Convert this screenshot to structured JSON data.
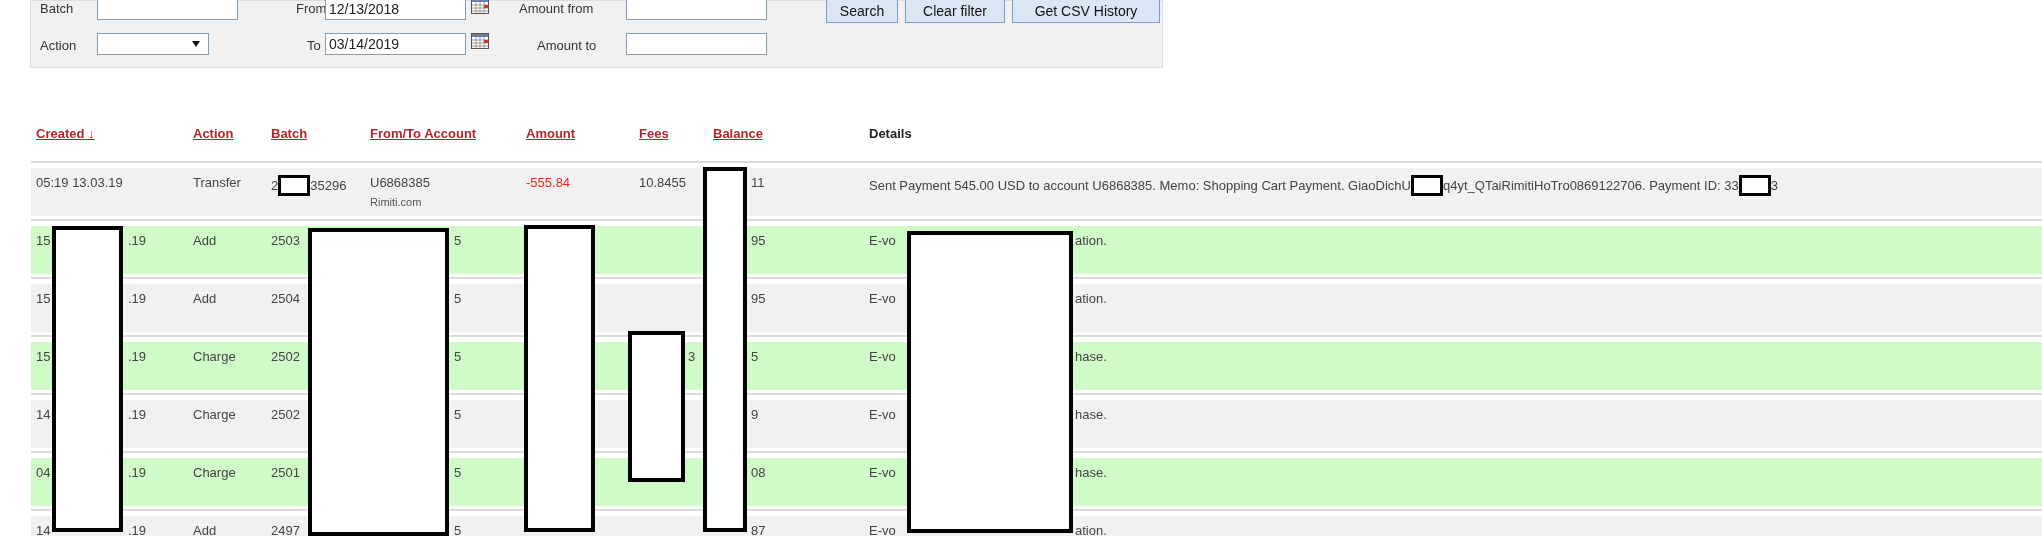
{
  "filters": {
    "batch_label": "Batch",
    "action_label": "Action",
    "from_label": "From",
    "from_value": "12/13/2018",
    "to_label": "To",
    "to_value": "03/14/2019",
    "amount_from_label": "Amount from",
    "amount_to_label": "Amount to"
  },
  "buttons": [
    "Search",
    "Clear filter",
    "Get CSV History"
  ],
  "table": {
    "columns": [
      {
        "label": "Created ↓",
        "sortable": true
      },
      {
        "label": "Action",
        "sortable": true
      },
      {
        "label": "Batch",
        "sortable": true
      },
      {
        "label": "From/To Account",
        "sortable": true
      },
      {
        "label": "Amount",
        "sortable": true
      },
      {
        "label": "Fees",
        "sortable": true
      },
      {
        "label": "Balance",
        "sortable": true
      },
      {
        "label": "Details",
        "sortable": false
      }
    ],
    "rows": [
      {
        "highlighted": false,
        "created": [
          "05:19 13.03.19"
        ],
        "action": [
          "Transfer"
        ],
        "batch": [
          "2",
          "35296"
        ],
        "account": [
          "U6868385"
        ],
        "account_sub": "Rimiti.com",
        "amount": [
          "-555.84"
        ],
        "amount_negative": true,
        "fees": [
          "10.8455"
        ],
        "balance": [
          "11"
        ],
        "details": [
          "Sent Payment 545.00 USD to account U6868385. Memo: Shopping Cart Payment. GiaoDichU",
          "q4yt_QTaiRimitiHoTro0869122706. Payment ID: 33",
          "3"
        ]
      },
      {
        "highlighted": true,
        "created": [
          "15",
          ".19"
        ],
        "action": [
          "Add"
        ],
        "batch": [
          "2503"
        ],
        "account": [
          "5"
        ],
        "balance": [
          "95"
        ],
        "details": [
          "E-vo",
          "ation."
        ]
      },
      {
        "highlighted": false,
        "created": [
          "15",
          ".19"
        ],
        "action": [
          "Add"
        ],
        "batch": [
          "2504"
        ],
        "account": [
          "5"
        ],
        "balance": [
          "95"
        ],
        "details": [
          "E-vo",
          "ation."
        ]
      },
      {
        "highlighted": true,
        "created": [
          "15",
          ".19"
        ],
        "action": [
          "Charge"
        ],
        "batch": [
          "2502"
        ],
        "account": [
          "5"
        ],
        "fees": [
          "3"
        ],
        "balance": [
          "5"
        ],
        "details": [
          "E-vo",
          "hase."
        ]
      },
      {
        "highlighted": false,
        "created": [
          "14",
          ".19"
        ],
        "action": [
          "Charge"
        ],
        "batch": [
          "2502"
        ],
        "account": [
          "5"
        ],
        "balance": [
          "9"
        ],
        "details": [
          "E-vo",
          "hase."
        ]
      },
      {
        "highlighted": true,
        "created": [
          "04",
          ".19"
        ],
        "action": [
          "Charge"
        ],
        "batch": [
          "2501"
        ],
        "account": [
          "5"
        ],
        "balance": [
          "08"
        ],
        "details": [
          "E-vo",
          "hase."
        ]
      },
      {
        "highlighted": false,
        "created": [
          "14",
          ".19"
        ],
        "action": [
          "Add"
        ],
        "batch": [
          "2497"
        ],
        "account": [
          "5"
        ],
        "balance": [
          "87"
        ],
        "details": [
          "E-vo",
          "ation."
        ]
      }
    ]
  }
}
